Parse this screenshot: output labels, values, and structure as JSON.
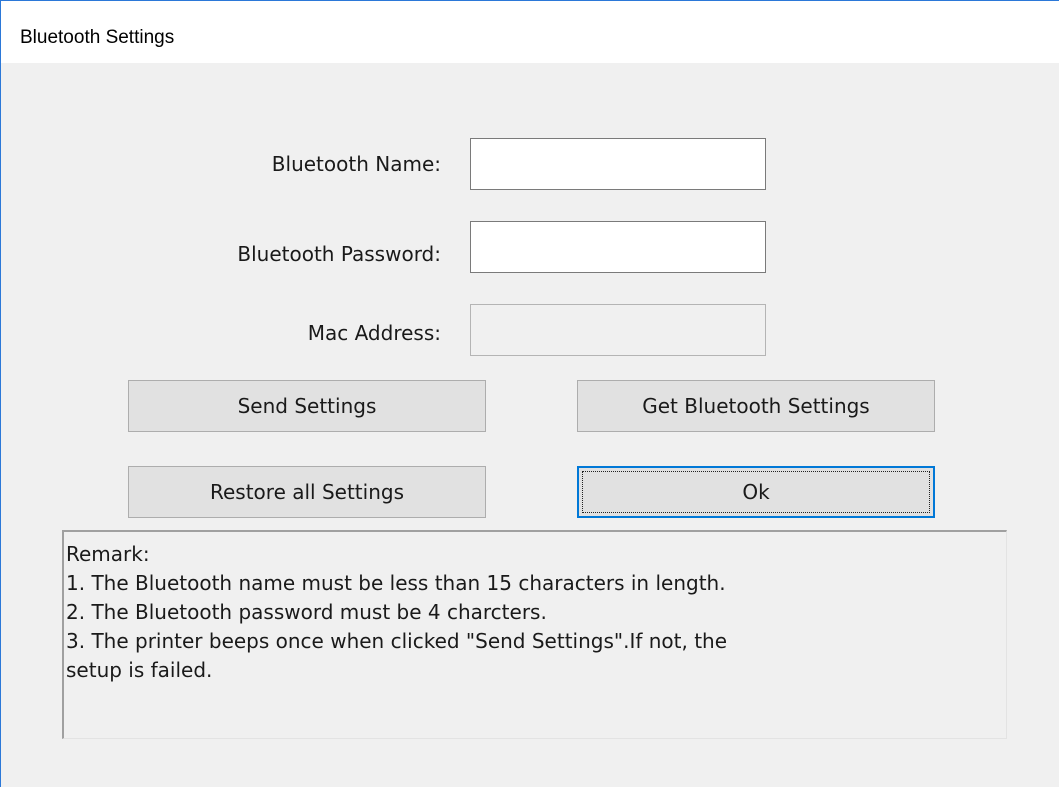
{
  "window": {
    "title": "Bluetooth Settings"
  },
  "form": {
    "name_label": "Bluetooth Name:",
    "name_value": "",
    "password_label": "Bluetooth Password:",
    "password_value": "",
    "mac_label": "Mac Address:",
    "mac_value": ""
  },
  "buttons": {
    "send_settings": "Send Settings",
    "get_settings": "Get Bluetooth Settings",
    "restore_all": "Restore all Settings",
    "ok": "Ok"
  },
  "remark": {
    "lines": [
      "Remark:",
      "1. The Bluetooth name must be less than 15 characters in length.",
      "2. The Bluetooth password must be 4 charcters.",
      "3. The printer beeps once when clicked  \"Send Settings\".If not, the",
      "setup is failed."
    ]
  },
  "colors": {
    "window_border": "#2b78d8",
    "dialog_bg": "#f0f0f0",
    "default_button_border": "#0078d7"
  }
}
